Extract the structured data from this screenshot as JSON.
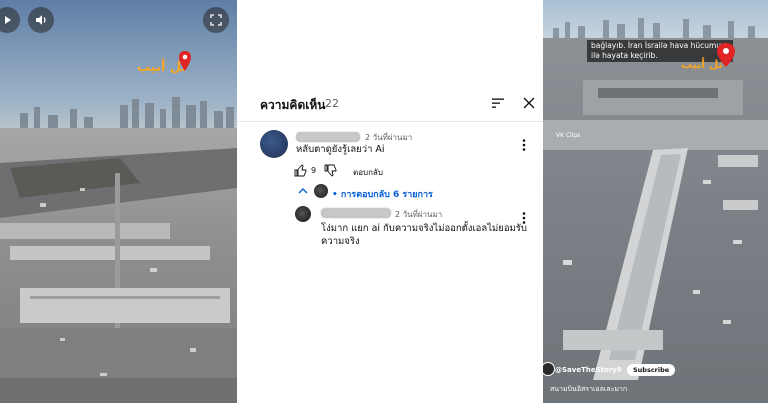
{
  "left_video": {
    "location_label": "تل أبيب",
    "icons": [
      "play-icon",
      "volume-icon",
      "fullscreen-icon",
      "location-pin-icon"
    ]
  },
  "comments": {
    "title": "ความคิดเห็น",
    "count": "22",
    "items": [
      {
        "time": "2 วันที่ผ่านมา",
        "text": "หลับตาดูยังรู้เลยว่า Ai",
        "likes": "9",
        "reply_label": "ตอบกลับ",
        "replies_toggle": "• การตอบกลับ 6 รายการ"
      },
      {
        "time": "2 วันที่ผ่านมา",
        "text_line1": "โง่มาก แยก ai กับความจริงไม่ออกตั้งเอลไม่ยอมรับ",
        "text_line2": "ความจริง"
      }
    ]
  },
  "right_video": {
    "caption": "bağlayıb. İran İsrailə hava hücumu ilə hayata keçirib.",
    "location_label": "تل أبيب",
    "small_label": "VK Clips",
    "channel": "@SaveTheStory9",
    "subscribe_label": "Subscribe",
    "description": "สนามบินอิสราเอลเละมาก"
  }
}
